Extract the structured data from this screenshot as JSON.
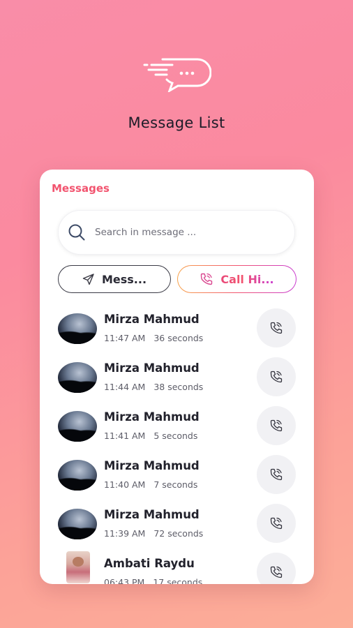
{
  "header": {
    "title": "Message List"
  },
  "card": {
    "title": "Messages",
    "search": {
      "placeholder": "Search in message ..."
    },
    "tabs": [
      {
        "label": "Mess...",
        "icon": "send-icon",
        "active": false
      },
      {
        "label": "Call Hi...",
        "icon": "phone-icon",
        "active": true
      }
    ]
  },
  "calls": [
    {
      "name": "Mirza Mahmud",
      "time": "11:47 AM",
      "duration": "36 seconds",
      "avatar": "night-sky-photo"
    },
    {
      "name": "Mirza Mahmud",
      "time": "11:44 AM",
      "duration": "38 seconds",
      "avatar": "night-sky-photo"
    },
    {
      "name": "Mirza Mahmud",
      "time": "11:41 AM",
      "duration": "5 seconds",
      "avatar": "night-sky-photo"
    },
    {
      "name": "Mirza Mahmud",
      "time": "11:40 AM",
      "duration": "7 seconds",
      "avatar": "night-sky-photo"
    },
    {
      "name": "Mirza Mahmud",
      "time": "11:39 AM",
      "duration": "72 seconds",
      "avatar": "night-sky-photo"
    },
    {
      "name": "Ambati Raydu",
      "time": "06:43 PM",
      "duration": "17 seconds",
      "avatar": "person-photo"
    }
  ],
  "colors": {
    "accent": "#f2546f",
    "gradient_start": "#f98da8",
    "gradient_end": "#fcae98"
  }
}
